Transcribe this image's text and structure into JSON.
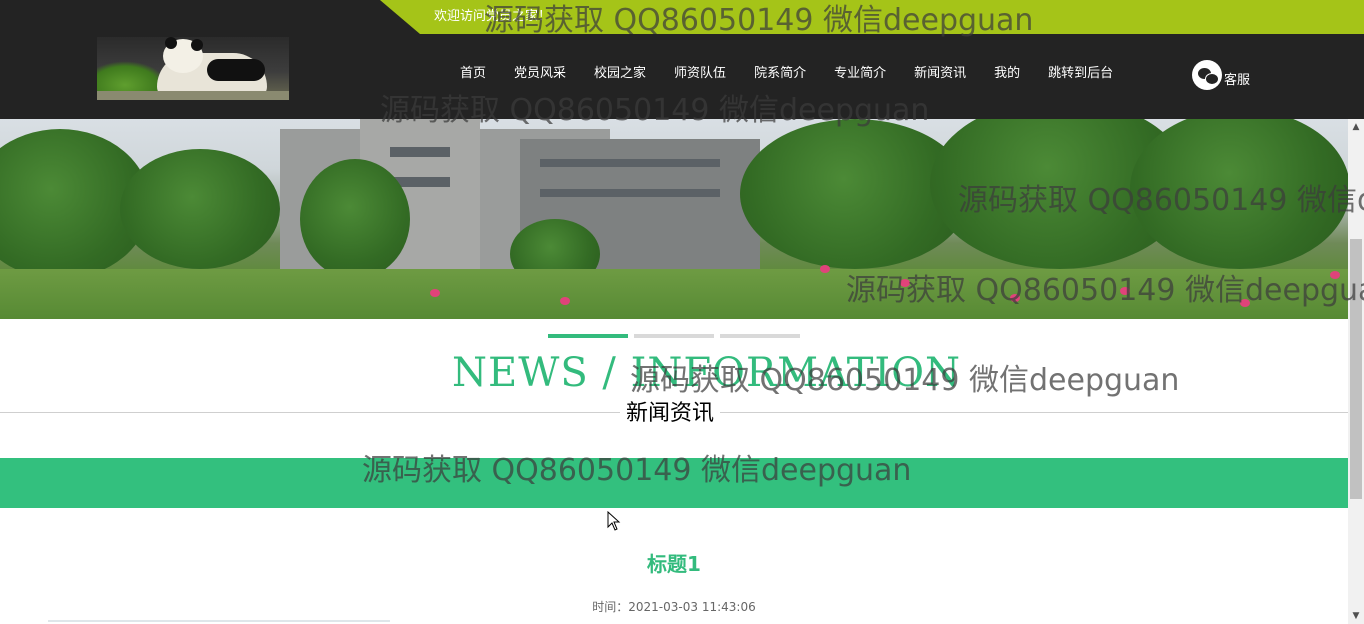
{
  "header": {
    "welcome": "欢迎访问党员之家！",
    "nav": [
      "首页",
      "党员风采",
      "校园之家",
      "师资队伍",
      "院系简介",
      "专业简介",
      "新闻资讯",
      "我的",
      "跳转到后台"
    ],
    "service_label": "客服"
  },
  "section": {
    "title_en": "NEWS / INFORMATION",
    "title_cn": "新闻资讯"
  },
  "article": {
    "title": "标题1",
    "time": "时间：2021-03-03 11:43:06"
  },
  "watermark": "源码获取 QQ86050149 微信deepguan",
  "colors": {
    "accent_green": "#33bb7d",
    "topbar": "#232323",
    "welcome_strip": "#a5c418"
  },
  "icons": {
    "service": "wechat-icon",
    "scroll_up": "▲",
    "scroll_down": "▼"
  }
}
